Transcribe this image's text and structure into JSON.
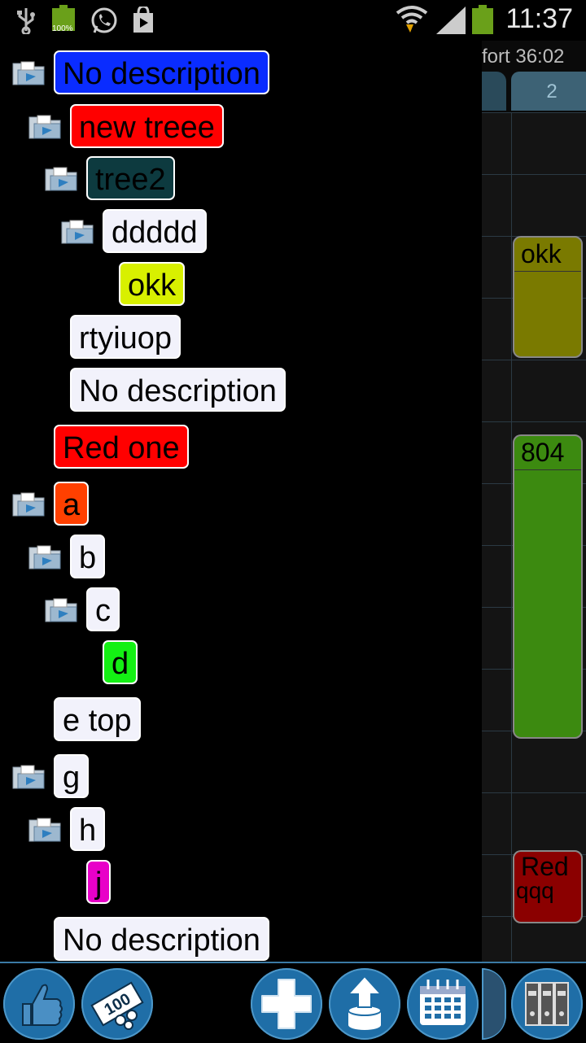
{
  "status_bar": {
    "battery_label": "100%",
    "time": "11:37"
  },
  "calendar": {
    "title": "fort 36:02",
    "tab_label": "2",
    "events": [
      {
        "title": "okk",
        "color": "#7a7a00"
      },
      {
        "title": "804",
        "color": "#3c8a10"
      },
      {
        "title": "Red",
        "subtitle": "qqq",
        "color": "#8b0000"
      }
    ]
  },
  "tree": {
    "items": [
      {
        "label": "No description",
        "color": "#0a2cff",
        "folder": true
      },
      {
        "label": "new treee",
        "color": "#ff0000",
        "folder": true
      },
      {
        "label": "tree2",
        "color": "#0d3a3f",
        "folder": true
      },
      {
        "label": "ddddd",
        "color": "#f2f2fb",
        "folder": true
      },
      {
        "label": "okk",
        "color": "#d8f000",
        "folder": false
      },
      {
        "label": "rtyiuop",
        "color": "#f2f2fb",
        "folder": false
      },
      {
        "label": "No description",
        "color": "#f2f2fb",
        "folder": false
      },
      {
        "label": "Red one",
        "color": "#ff0000",
        "folder": false
      },
      {
        "label": "a",
        "color": "#ff4000",
        "folder": true
      },
      {
        "label": "b",
        "color": "#f2f2fb",
        "folder": true
      },
      {
        "label": "c",
        "color": "#f2f2fb",
        "folder": true
      },
      {
        "label": "d",
        "color": "#14f014",
        "folder": false
      },
      {
        "label": "e top",
        "color": "#f2f2fb",
        "folder": false
      },
      {
        "label": "g",
        "color": "#f2f2fb",
        "folder": true
      },
      {
        "label": "h",
        "color": "#f2f2fb",
        "folder": true
      },
      {
        "label": "j",
        "color": "#e800c8",
        "folder": false
      },
      {
        "label": "No description",
        "color": "#f2f2fb",
        "folder": false
      }
    ]
  },
  "bottom_bar": {
    "buttons": [
      "thumbs-up-icon",
      "money-icon",
      "plus-icon",
      "upload-database-icon",
      "calendar-icon",
      "binders-icon"
    ],
    "money_label": "100"
  }
}
